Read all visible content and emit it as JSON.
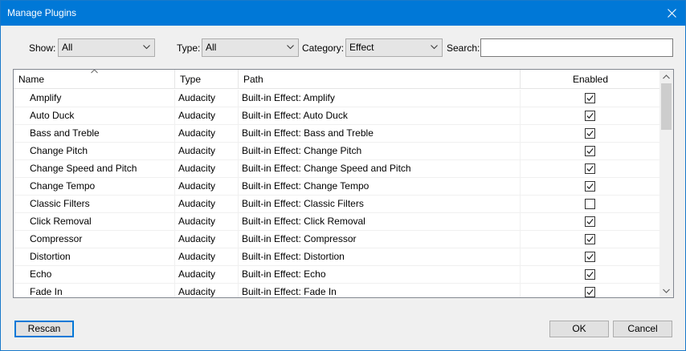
{
  "window": {
    "title": "Manage Plugins"
  },
  "filters": {
    "show_label": "Show:",
    "show_value": "All",
    "type_label": "Type:",
    "type_value": "All",
    "category_label": "Category:",
    "category_value": "Effect",
    "search_label": "Search:",
    "search_value": ""
  },
  "columns": {
    "name": "Name",
    "type": "Type",
    "path": "Path",
    "enabled": "Enabled"
  },
  "rows": [
    {
      "name": "Amplify",
      "type": "Audacity",
      "path": "Built-in Effect: Amplify",
      "enabled": true
    },
    {
      "name": "Auto Duck",
      "type": "Audacity",
      "path": "Built-in Effect: Auto Duck",
      "enabled": true
    },
    {
      "name": "Bass and Treble",
      "type": "Audacity",
      "path": "Built-in Effect: Bass and Treble",
      "enabled": true
    },
    {
      "name": "Change Pitch",
      "type": "Audacity",
      "path": "Built-in Effect: Change Pitch",
      "enabled": true
    },
    {
      "name": "Change Speed and Pitch",
      "type": "Audacity",
      "path": "Built-in Effect: Change Speed and Pitch",
      "enabled": true
    },
    {
      "name": "Change Tempo",
      "type": "Audacity",
      "path": "Built-in Effect: Change Tempo",
      "enabled": true
    },
    {
      "name": "Classic Filters",
      "type": "Audacity",
      "path": "Built-in Effect: Classic Filters",
      "enabled": false
    },
    {
      "name": "Click Removal",
      "type": "Audacity",
      "path": "Built-in Effect: Click Removal",
      "enabled": true
    },
    {
      "name": "Compressor",
      "type": "Audacity",
      "path": "Built-in Effect: Compressor",
      "enabled": true
    },
    {
      "name": "Distortion",
      "type": "Audacity",
      "path": "Built-in Effect: Distortion",
      "enabled": true
    },
    {
      "name": "Echo",
      "type": "Audacity",
      "path": "Built-in Effect: Echo",
      "enabled": true
    },
    {
      "name": "Fade In",
      "type": "Audacity",
      "path": "Built-in Effect: Fade In",
      "enabled": true
    }
  ],
  "buttons": {
    "rescan": "Rescan",
    "ok": "OK",
    "cancel": "Cancel"
  },
  "colors": {
    "titlebar": "#0078d7",
    "focus": "#0078d7"
  },
  "icons": {
    "close": "close-icon",
    "dropdown": "chevron-down-icon",
    "sort": "sort-up-icon",
    "check": "check-icon"
  }
}
